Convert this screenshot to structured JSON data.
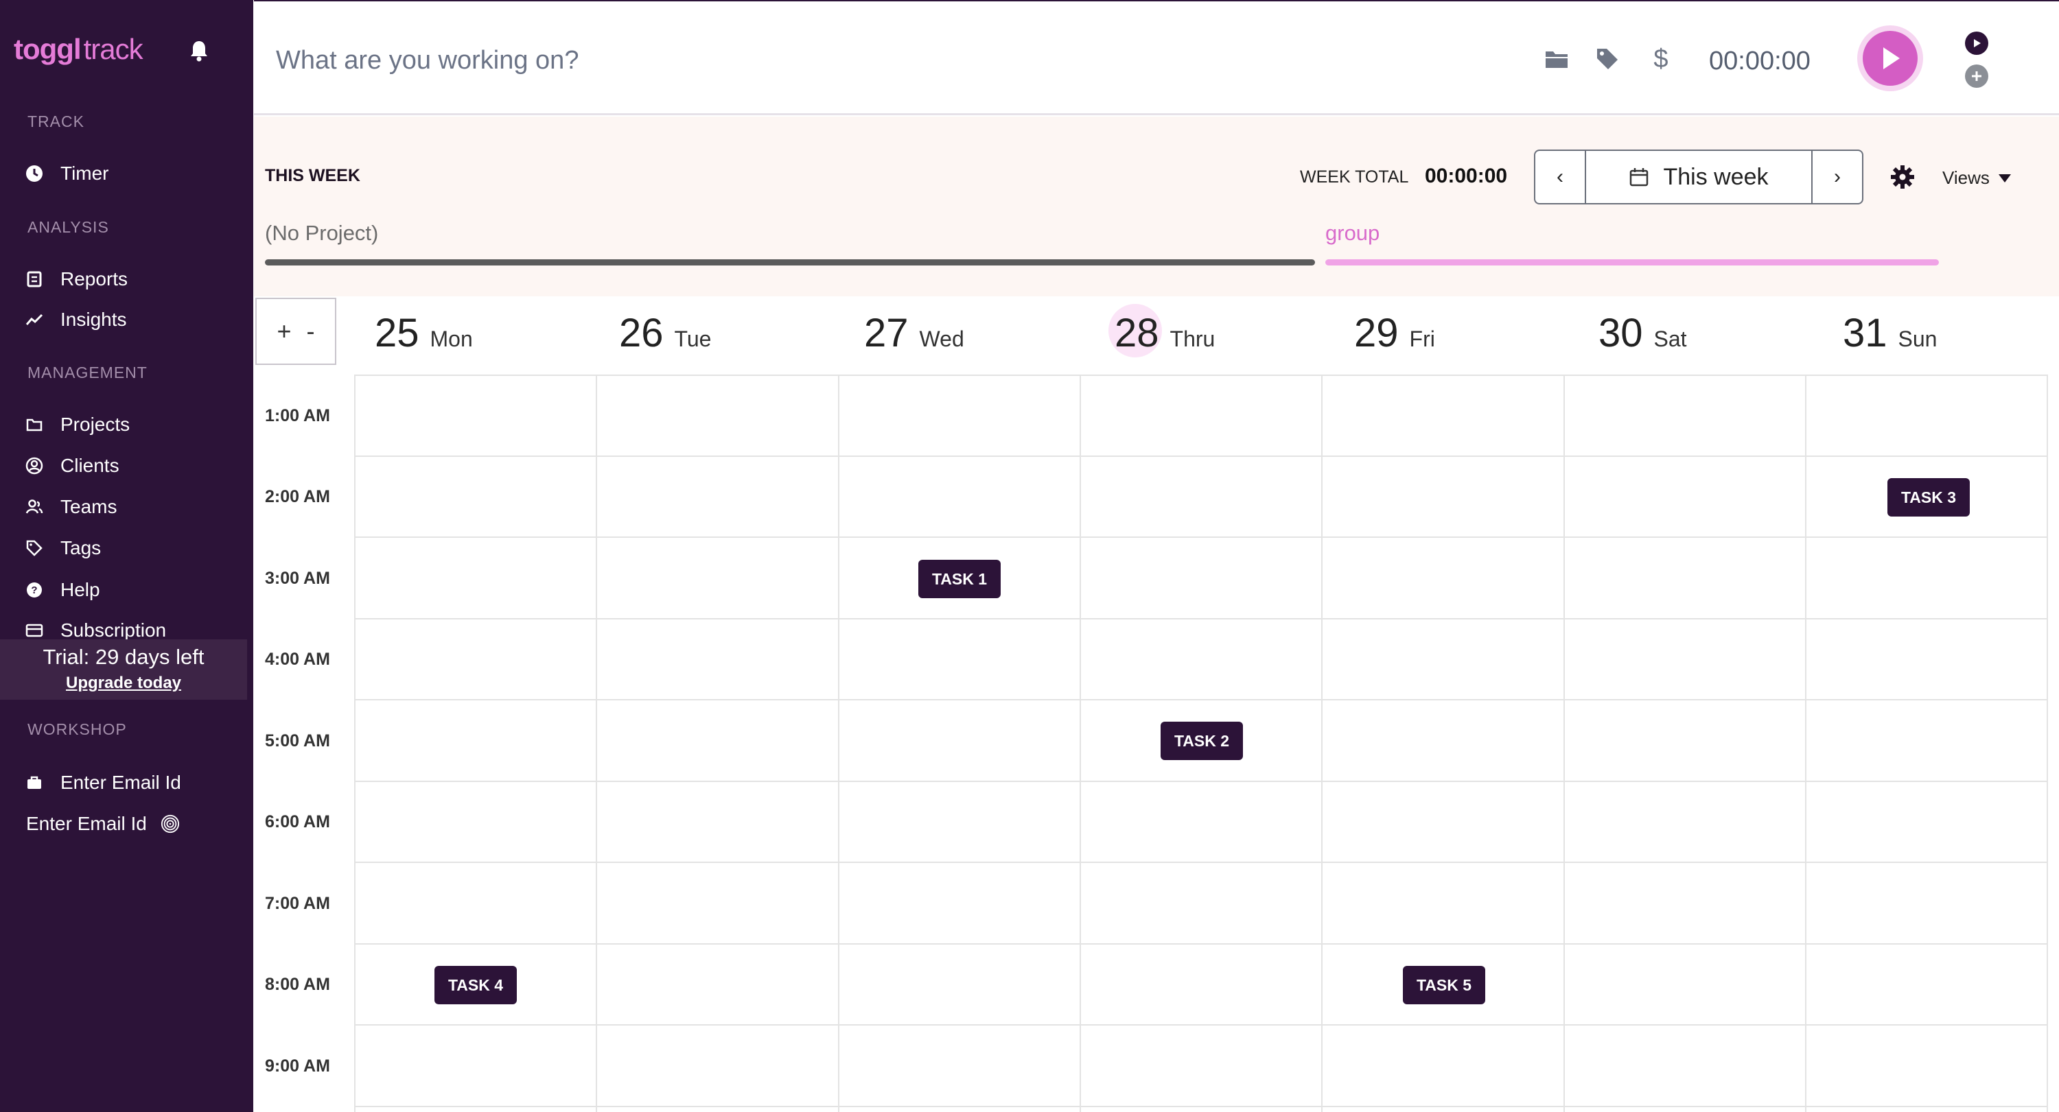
{
  "app": {
    "logo_brand": "toggl",
    "logo_product": "track",
    "accent_color": "#e57cd8",
    "sidebar_color": "#2c1338"
  },
  "sidebar": {
    "sections": {
      "track": "TRACK",
      "analysis": "ANALYSIS",
      "management": "MANAGEMENT",
      "workshop": "WORKSHOP"
    },
    "items": {
      "timer": "Timer",
      "reports": "Reports",
      "insights": "Insights",
      "projects": "Projects",
      "clients": "Clients",
      "teams": "Teams",
      "tags": "Tags",
      "help": "Help",
      "subscription": "Subscription"
    },
    "trial": {
      "text": "Trial: 29 days left",
      "upgrade": "Upgrade today"
    },
    "workshop": {
      "item": "Enter Email Id",
      "profile": "Enter Email Id"
    }
  },
  "topbar": {
    "description_placeholder": "What are you working on?",
    "icons": [
      "folder-icon",
      "tag-icon",
      "dollar-icon"
    ],
    "billable_symbol": "$",
    "timer": "00:00:00"
  },
  "week": {
    "title": "THIS WEEK",
    "total_label": "WEEK TOTAL",
    "total_value": "00:00:00",
    "range_label": "This week",
    "views_label": "Views",
    "prev": "‹",
    "next": "›",
    "projects": [
      {
        "name": "(No Project)",
        "color": "#5b5b5b",
        "text_color": "#6b6b6b"
      },
      {
        "name": "group",
        "color": "#f0a3e6",
        "text_color": "#d86bcb"
      }
    ]
  },
  "zoom": {
    "plus": "+",
    "minus": "-"
  },
  "days": [
    {
      "num": "25",
      "name": "Mon"
    },
    {
      "num": "26",
      "name": "Tue"
    },
    {
      "num": "27",
      "name": "Wed"
    },
    {
      "num": "28",
      "name": "Thru",
      "today": true
    },
    {
      "num": "29",
      "name": "Fri"
    },
    {
      "num": "30",
      "name": "Sat"
    },
    {
      "num": "31",
      "name": "Sun"
    }
  ],
  "hours": [
    "1:00 AM",
    "2:00 AM",
    "3:00 AM",
    "4:00 AM",
    "5:00 AM",
    "6:00 AM",
    "7:00 AM",
    "8:00 AM",
    "9:00 AM"
  ],
  "tasks": [
    {
      "label": "TASK 1",
      "day": "27 Wed",
      "hour": "3:00 AM"
    },
    {
      "label": "TASK 2",
      "day": "28 Thru",
      "hour": "5:00 AM"
    },
    {
      "label": "TASK 3",
      "day": "31 Sun",
      "hour": "2:00 AM"
    },
    {
      "label": "TASK 4",
      "day": "25 Mon",
      "hour": "8:00 AM"
    },
    {
      "label": "TASK 5",
      "day": "29 Fri",
      "hour": "8:00 AM"
    }
  ]
}
